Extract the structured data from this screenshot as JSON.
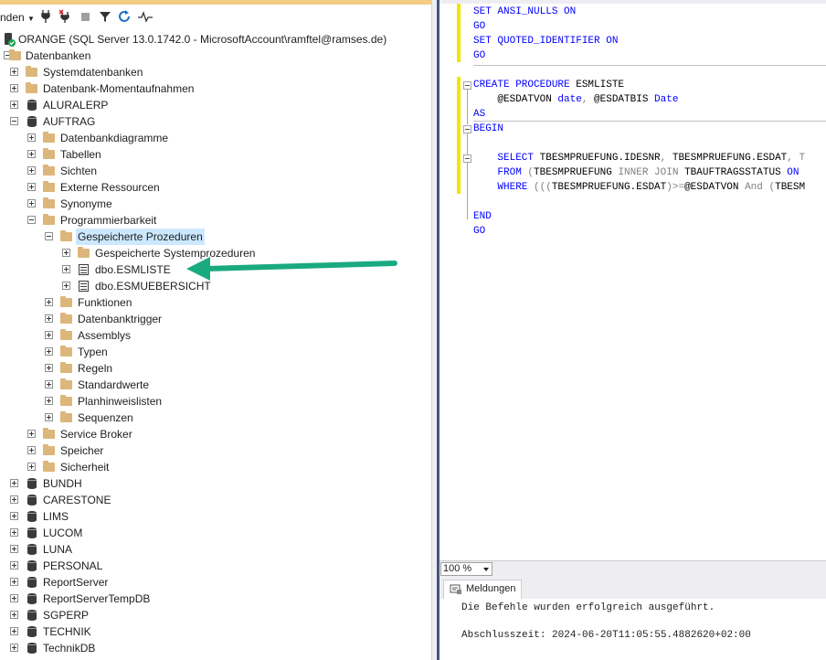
{
  "toolbar": {
    "connect_label": "nden",
    "icons": [
      "connect-dropdown-icon",
      "connect-plug-icon",
      "disconnect-icon",
      "stop-icon",
      "filter-icon",
      "refresh-icon",
      "activity-monitor-icon"
    ]
  },
  "tree": {
    "server": "ORANGE (SQL Server 13.0.1742.0 - MicrosoftAccount\\ramftel@ramses.de)",
    "databases_label": "Datenbanken",
    "system_db": "Systemdatenbanken",
    "snapshots": "Datenbank-Momentaufnahmen",
    "db_aluralerp": "ALURALERP",
    "db_auftrag": "AUFTRAG",
    "auftrag_children": {
      "diagrams": "Datenbankdiagramme",
      "tables": "Tabellen",
      "views": "Sichten",
      "external": "Externe Ressourcen",
      "synonyms": "Synonyme",
      "programmability": "Programmierbarkeit",
      "stored_procs": "Gespeicherte Prozeduren",
      "system_procs": "Gespeicherte Systemprozeduren",
      "proc1": "dbo.ESMLISTE",
      "proc2": "dbo.ESMUEBERSICHT",
      "functions": "Funktionen",
      "db_triggers": "Datenbanktrigger",
      "assemblies": "Assemblys",
      "types": "Typen",
      "rules": "Regeln",
      "defaults": "Standardwerte",
      "plan_guides": "Planhinweislisten",
      "sequences": "Sequenzen",
      "service_broker": "Service Broker",
      "storage": "Speicher",
      "security": "Sicherheit"
    },
    "more_dbs": [
      "BUNDH",
      "CARESTONE",
      "LIMS",
      "LUCOM",
      "LUNA",
      "PERSONAL",
      "ReportServer",
      "ReportServerTempDB",
      "SGPERP",
      "TECHNIK",
      "TechnikDB"
    ]
  },
  "editor": {
    "lines": {
      "l1a": "SET ",
      "l1b": "ANSI_NULLS ",
      "l1c": "ON",
      "l2": "GO",
      "l3a": "SET ",
      "l3b": "QUOTED_IDENTIFIER ",
      "l3c": "ON",
      "l4": "GO",
      "l5a": "CREATE PROCEDURE ",
      "l5b": "ESMLISTE",
      "l6a": "    @ESDATVON ",
      "l6b": "date",
      "l6c": ", ",
      "l6d": "@ESDATBIS ",
      "l6e": "Date",
      "l7": "AS",
      "l8": "BEGIN",
      "l9a": "    SELECT ",
      "l9b": "TBESMPRUEFUNG.IDESNR",
      "l9c": ", ",
      "l9d": "TBESMPRUEFUNG.ESDAT",
      "l9e": ", T",
      "l10a": "    FROM ",
      "l10b": "(",
      "l10c": "TBESMPRUEFUNG ",
      "l10d": "INNER JOIN ",
      "l10e": "TBAUFTRAGSSTATUS ",
      "l10f": "ON ",
      "l11a": "    WHERE ",
      "l11b": "(((",
      "l11c": "TBESMPRUEFUNG.ESDAT",
      "l11d": ")>=",
      "l11e": "@ESDATVON ",
      "l11f": "And ",
      "l11g": "(",
      "l11h": "TBESM",
      "l12": "END",
      "l13": "GO"
    }
  },
  "zoom": {
    "value": "100 %"
  },
  "results": {
    "tab_label": "Meldungen",
    "line1": "Die Befehle wurden erfolgreich ausgeführt.",
    "line2": "Abschlusszeit: 2024-06-20T11:05:55.4882620+02:00"
  },
  "colors": {
    "keyword": "#0000ff",
    "gray_keyword": "#808080",
    "function": "#ff00ff",
    "annotation_arrow": "#1aaa80",
    "change_marker": "#f2e500"
  }
}
